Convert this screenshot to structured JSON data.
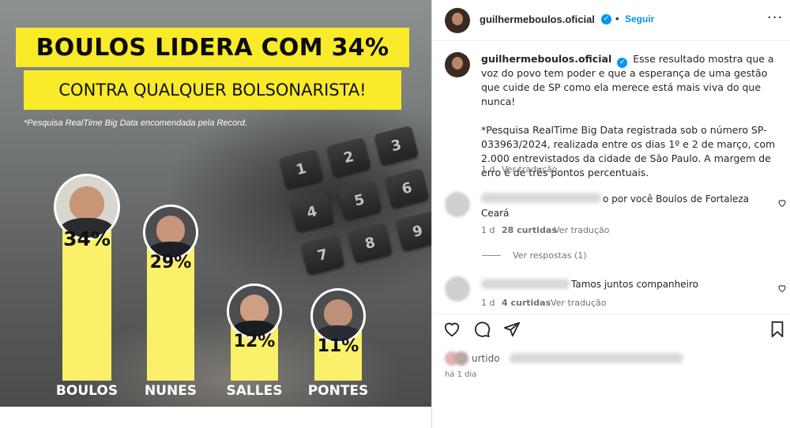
{
  "post_image": {
    "headline": "BOULOS LIDERA COM 34%",
    "subheadline": "CONTRA QUALQUER BOLSONARISTA!",
    "source_note": "*Pesquisa RealTime Big Data encomendada pela Record.",
    "keypad_keys": [
      "1",
      "2",
      "3",
      "4",
      "5",
      "6",
      "7",
      "8",
      "9"
    ],
    "candidates": [
      {
        "name": "BOULOS",
        "percent": "34%",
        "value": 34
      },
      {
        "name": "NUNES",
        "percent": "29%",
        "value": 29
      },
      {
        "name": "SALLES",
        "percent": "12%",
        "value": 12
      },
      {
        "name": "PONTES",
        "percent": "11%",
        "value": 11
      }
    ],
    "colors": {
      "highlight_yellow": "#f9ea2a",
      "bar_yellow": "#fbf06a"
    }
  },
  "header": {
    "username": "guilhermeboulos.oficial",
    "separator": "•",
    "follow_label": "Seguir",
    "more_icon": "more-horizontal-icon"
  },
  "caption": {
    "username": "guilhermeboulos.oficial",
    "text_1": "Esse resultado mostra que a voz do povo tem poder e que a esperança de uma gestão que cuide de SP como ela merece está mais viva do que nunca!",
    "text_2": "*Pesquisa RealTime Big Data registrada sob o número SP-033963/2024, realizada entre os dias 1º e 2 de março, com 2.000 entrevistados da cidade de São Paulo. A margem de erro é de três pontos percentuais.",
    "time": "1 d",
    "translate_label": "Ver tradução"
  },
  "comments": [
    {
      "visible_text": "o por você Boulos de Fortaleza",
      "visible_text_line2": "Ceará",
      "time": "1 d",
      "likes": "28 curtidas",
      "translate_label": "Ver tradução",
      "replies_label": "Ver respostas (1)"
    },
    {
      "visible_text": "Tamos juntos companheiro",
      "time": "1 d",
      "likes": "4 curtidas",
      "translate_label": "Ver tradução"
    }
  ],
  "actions": {
    "like_icon": "heart-icon",
    "comment_icon": "comment-icon",
    "share_icon": "share-icon",
    "save_icon": "bookmark-icon"
  },
  "likes_summary": {
    "visible_text": "urtido",
    "posted_time": "há 1 dia"
  },
  "brand": {
    "link_blue": "#0095f6",
    "text_dark": "#262626",
    "text_muted": "#737373"
  }
}
